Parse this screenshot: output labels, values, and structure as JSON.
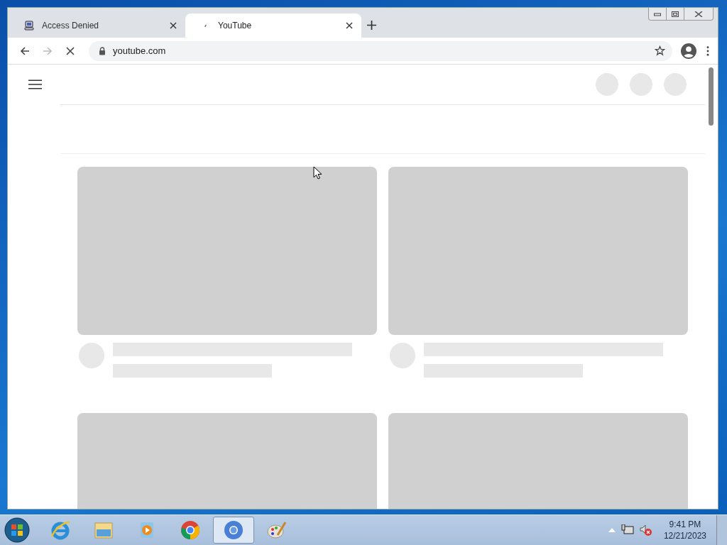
{
  "browser": {
    "tabs": [
      {
        "title": "Access Denied",
        "selected": false,
        "loading": false
      },
      {
        "title": "YouTube",
        "selected": true,
        "loading": true
      }
    ],
    "address": "youtube.com",
    "loading": true
  },
  "taskbar": {
    "items": [
      {
        "kind": "ie",
        "selected": false
      },
      {
        "kind": "explorer",
        "selected": false
      },
      {
        "kind": "media",
        "selected": false
      },
      {
        "kind": "chrome",
        "selected": false
      },
      {
        "kind": "chromium",
        "selected": true
      },
      {
        "kind": "paint",
        "selected": false
      }
    ],
    "time": "9:41 PM",
    "date": "12/21/2023"
  }
}
